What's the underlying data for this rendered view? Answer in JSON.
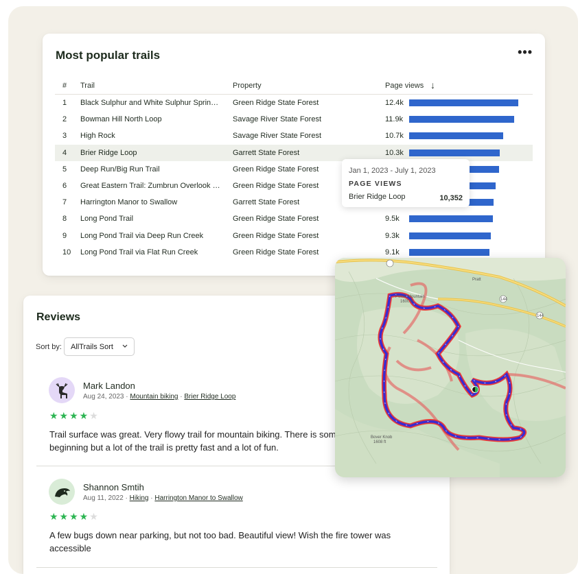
{
  "trails_card": {
    "title": "Most popular trails",
    "more_label": "•••",
    "columns": {
      "num": "#",
      "trail": "Trail",
      "property": "Property",
      "views": "Page views",
      "sort_icon": "↓"
    },
    "rows": [
      {
        "num": "1",
        "trail": "Black Sulphur and White Sulphur Springs Trail",
        "trail_display": "Black Sulphur and White Sulphur Spring…",
        "property": "Green Ridge State Forest",
        "views": "12.4k",
        "value": 12.4
      },
      {
        "num": "2",
        "trail": "Bowman Hill North Loop",
        "trail_display": "Bowman Hill North Loop",
        "property": "Savage River State Forest",
        "views": "11.9k",
        "value": 11.9
      },
      {
        "num": "3",
        "trail": "High Rock",
        "trail_display": "High Rock",
        "property": "Savage River State Forest",
        "views": "10.7k",
        "value": 10.7
      },
      {
        "num": "4",
        "trail": "Brier Ridge Loop",
        "trail_display": "Brier Ridge Loop",
        "property": "Garrett State Forest",
        "views": "10.3k",
        "value": 10.3
      },
      {
        "num": "5",
        "trail": "Deep Run/Big Run Trail",
        "trail_display": "Deep Run/Big Run Trail",
        "property": "Green Ridge State Forest",
        "views": "",
        "value": 10.2
      },
      {
        "num": "6",
        "trail": "Great Eastern Trail: Zumbrun Overlook trail",
        "trail_display": "Great Eastern Trail: Zumbrun Overlook t…",
        "property": "Green Ridge State Forest",
        "views": "",
        "value": 9.8
      },
      {
        "num": "7",
        "trail": "Harrington Manor to Swallow",
        "trail_display": "Harrington Manor to Swallow",
        "property": "Garrett State Forest",
        "views": "",
        "value": 9.6
      },
      {
        "num": "8",
        "trail": "Long Pond Trail",
        "trail_display": "Long Pond Trail",
        "property": "Green Ridge State Forest",
        "views": "9.5k",
        "value": 9.5
      },
      {
        "num": "9",
        "trail": "Long Pond Trail via Deep Run Creek",
        "trail_display": "Long Pond Trail via Deep Run Creek",
        "property": "Green Ridge State Forest",
        "views": "9.3k",
        "value": 9.3
      },
      {
        "num": "10",
        "trail": "Long Pond Trail via Flat Run Creek",
        "trail_display": "Long Pond Trail via Flat Run Creek",
        "property": "Green Ridge State Forest",
        "views": "9.1k",
        "value": 9.1
      }
    ],
    "highlight_row": 3,
    "bar_color": "#2f66cc",
    "tooltip": {
      "date_range": "Jan 1, 2023 - July 1, 2023",
      "heading": "PAGE VIEWS",
      "trail": "Brier Ridge Loop",
      "value": "10,352"
    }
  },
  "reviews_card": {
    "title": "Reviews",
    "sort_label": "Sort by:",
    "sort_value": "AllTrails Sort",
    "reviews": [
      {
        "name": "Mark Landon",
        "date": "Aug 24, 2023",
        "activity": "Mountain biking",
        "trail": "Brier Ridge Loop",
        "rating": 4,
        "text": "Trail surface was great. Very flowy trail for mountain biking. There is som",
        "text2": "beginning but a lot of the trail is pretty fast and a lot of fun.",
        "avatar_color": "#e4d8f7"
      },
      {
        "name": "Shannon Smtih",
        "date": "Aug 11, 2022",
        "activity": "Hiking",
        "trail": "Harrington Manor to Swallow",
        "rating": 4,
        "text": "A few bugs down near parking, but not too bad. Beautiful view! Wish the fire tower was",
        "text2": "accessible",
        "avatar_color": "#d9ecd7"
      }
    ],
    "star_color": "#2db553"
  },
  "map": {
    "labels": {
      "peak1": "Polish Mountain",
      "peak1_elev": "1600 ft",
      "peak2": "Bover Knob",
      "peak2_elev": "1608 ft",
      "town": "Pratt",
      "route1": "144",
      "route2": "144"
    },
    "route_color": "#3a2bd0",
    "route_outline": "#e83a3a"
  },
  "meta_sep": "·"
}
